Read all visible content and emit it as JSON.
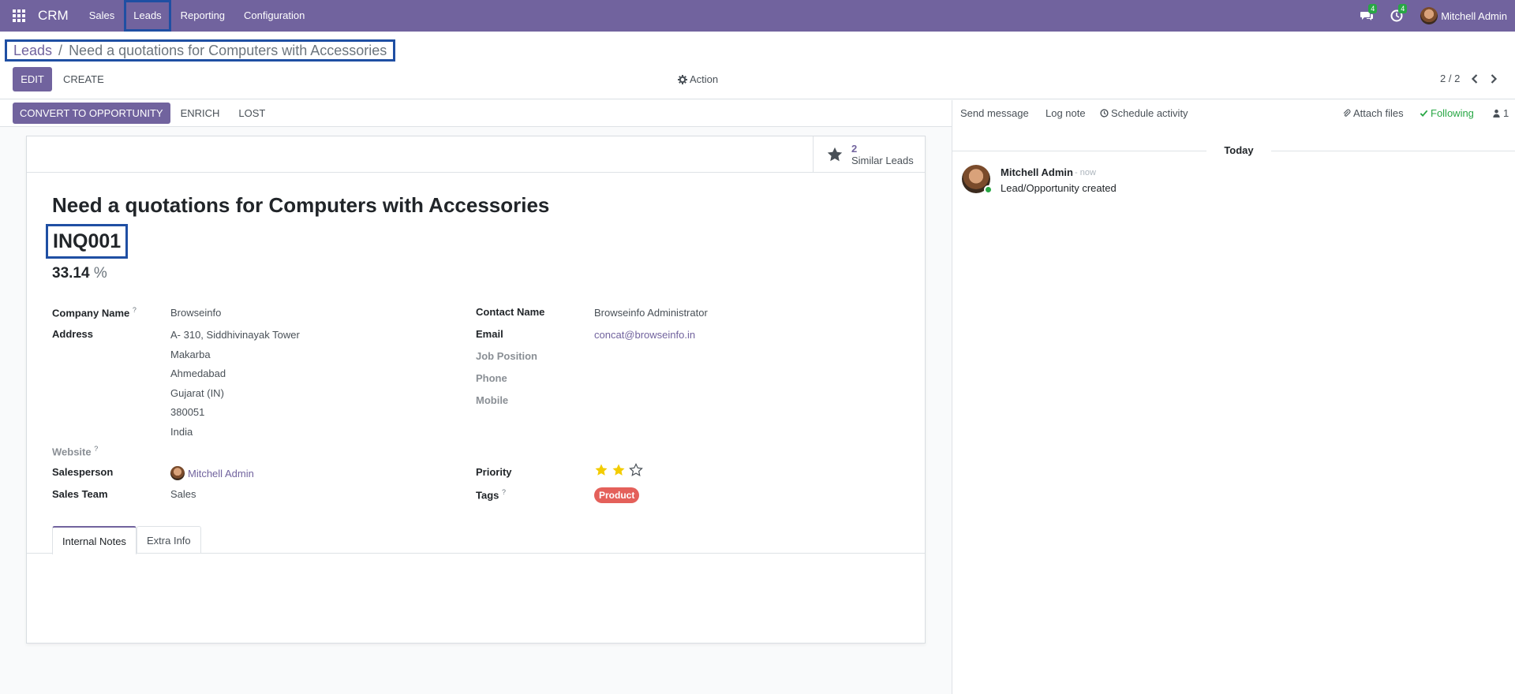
{
  "navbar": {
    "app_name": "CRM",
    "menus": [
      "Sales",
      "Leads",
      "Reporting",
      "Configuration"
    ],
    "messages_count": "4",
    "activities_count": "4",
    "user_name": "Mitchell Admin"
  },
  "control": {
    "breadcrumb_parent": "Leads",
    "breadcrumb_separator": "/",
    "breadcrumb_current": "Need a quotations for Computers with Accessories",
    "edit_label": "EDIT",
    "create_label": "CREATE",
    "action_label": "Action",
    "pager": "2 / 2"
  },
  "statusbar": {
    "convert_label": "CONVERT TO OPPORTUNITY",
    "enrich_label": "ENRICH",
    "lost_label": "LOST"
  },
  "smart_button": {
    "value": "2",
    "label": "Similar Leads"
  },
  "lead": {
    "title": "Need a quotations for Computers with Accessories",
    "reference": "INQ001",
    "probability": "33.14",
    "probability_unit": "%"
  },
  "fields": {
    "company_name_label": "Company Name",
    "company_name": "Browseinfo",
    "address_label": "Address",
    "address_lines": [
      "A- 310, Siddhivinayak Tower",
      "Makarba",
      "Ahmedabad",
      "Gujarat (IN)",
      "380051",
      "India"
    ],
    "website_label": "Website",
    "salesperson_label": "Salesperson",
    "salesperson": "Mitchell Admin",
    "sales_team_label": "Sales Team",
    "sales_team": "Sales",
    "contact_name_label": "Contact Name",
    "contact_name": "Browseinfo Administrator",
    "email_label": "Email",
    "email": "concat@browseinfo.in",
    "job_position_label": "Job Position",
    "phone_label": "Phone",
    "mobile_label": "Mobile",
    "priority_label": "Priority",
    "priority_value": 2,
    "priority_max": 3,
    "tags_label": "Tags",
    "tag": "Product",
    "help_mark": "?"
  },
  "tabs": [
    "Internal Notes",
    "Extra Info"
  ],
  "chatter": {
    "send_message": "Send message",
    "log_note": "Log note",
    "schedule_activity": "Schedule activity",
    "attach_files": "Attach files",
    "following": "Following",
    "followers_count": "1",
    "date_separator": "Today",
    "message_author": "Mitchell Admin",
    "message_time": "- now",
    "message_body": "Lead/Opportunity created"
  },
  "colors": {
    "brand": "#71639e",
    "tag": "#e4605a",
    "star": "#f3cc00",
    "following": "#28a745",
    "highlight": "#1f4fa3"
  }
}
